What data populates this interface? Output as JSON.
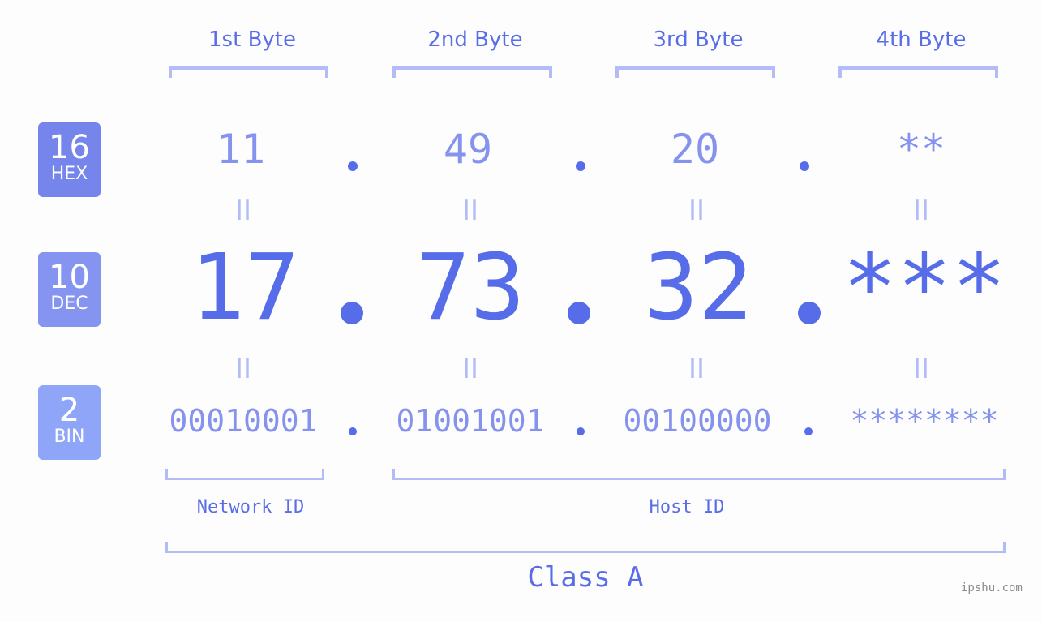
{
  "byte_headers": [
    "1st Byte",
    "2nd Byte",
    "3rd Byte",
    "4th Byte"
  ],
  "badges": [
    {
      "num": "16",
      "label": "HEX",
      "color": "#7685ec"
    },
    {
      "num": "10",
      "label": "DEC",
      "color": "#8494f0"
    },
    {
      "num": "2",
      "label": "BIN",
      "color": "#8fa6f8"
    }
  ],
  "hex": [
    "11",
    "49",
    "20",
    "**"
  ],
  "dec": [
    "17",
    "73",
    "32",
    "***"
  ],
  "bin": [
    "00010001",
    "01001001",
    "00100000",
    "********"
  ],
  "separator": ".",
  "equals": "II",
  "network_id_label": "Network ID",
  "host_id_label": "Host ID",
  "class_label": "Class A",
  "watermark": "ipshu.com",
  "colors": {
    "primary": "#566ce9",
    "light": "#8593ee",
    "bracket": "#b3bcf6"
  }
}
